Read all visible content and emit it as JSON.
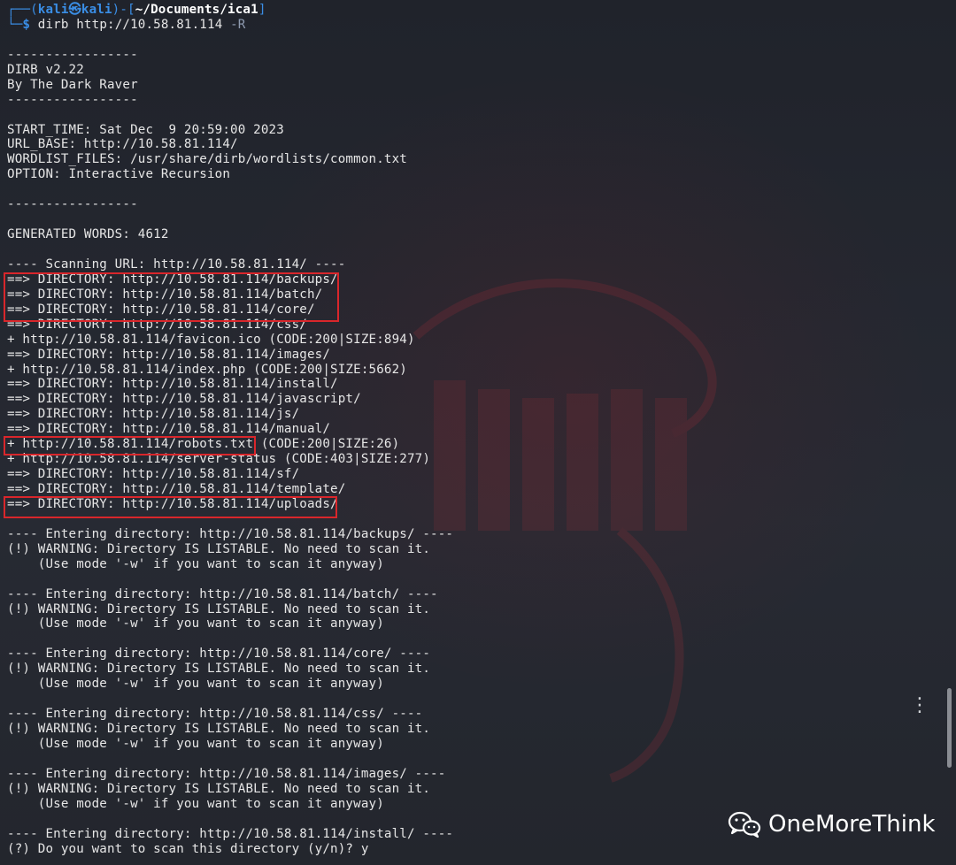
{
  "terminal": {
    "prompt": {
      "frame_start": "┌──(",
      "user": "kali㉿kali",
      "frame_mid": ")-[",
      "path": "~/Documents/ica1",
      "frame_end": "]",
      "frame_second": "└─",
      "dollar": "$ ",
      "command": "dirb http://10.58.81.114 ",
      "flag": "-R"
    },
    "lines": [
      "",
      "-----------------",
      "DIRB v2.22",
      "By The Dark Raver",
      "-----------------",
      "",
      "START_TIME: Sat Dec  9 20:59:00 2023",
      "URL_BASE: http://10.58.81.114/",
      "WORDLIST_FILES: /usr/share/dirb/wordlists/common.txt",
      "OPTION: Interactive Recursion",
      "",
      "-----------------",
      "",
      "GENERATED WORDS: 4612",
      "",
      "---- Scanning URL: http://10.58.81.114/ ----",
      "==> DIRECTORY: http://10.58.81.114/backups/",
      "==> DIRECTORY: http://10.58.81.114/batch/",
      "==> DIRECTORY: http://10.58.81.114/core/",
      "==> DIRECTORY: http://10.58.81.114/css/",
      "+ http://10.58.81.114/favicon.ico (CODE:200|SIZE:894)",
      "==> DIRECTORY: http://10.58.81.114/images/",
      "+ http://10.58.81.114/index.php (CODE:200|SIZE:5662)",
      "==> DIRECTORY: http://10.58.81.114/install/",
      "==> DIRECTORY: http://10.58.81.114/javascript/",
      "==> DIRECTORY: http://10.58.81.114/js/",
      "==> DIRECTORY: http://10.58.81.114/manual/",
      "+ http://10.58.81.114/robots.txt (CODE:200|SIZE:26)",
      "+ http://10.58.81.114/server-status (CODE:403|SIZE:277)",
      "==> DIRECTORY: http://10.58.81.114/sf/",
      "==> DIRECTORY: http://10.58.81.114/template/",
      "==> DIRECTORY: http://10.58.81.114/uploads/",
      "",
      "---- Entering directory: http://10.58.81.114/backups/ ----",
      "(!) WARNING: Directory IS LISTABLE. No need to scan it.",
      "    (Use mode '-w' if you want to scan it anyway)",
      "",
      "---- Entering directory: http://10.58.81.114/batch/ ----",
      "(!) WARNING: Directory IS LISTABLE. No need to scan it.",
      "    (Use mode '-w' if you want to scan it anyway)",
      "",
      "---- Entering directory: http://10.58.81.114/core/ ----",
      "(!) WARNING: Directory IS LISTABLE. No need to scan it.",
      "    (Use mode '-w' if you want to scan it anyway)",
      "",
      "---- Entering directory: http://10.58.81.114/css/ ----",
      "(!) WARNING: Directory IS LISTABLE. No need to scan it.",
      "    (Use mode '-w' if you want to scan it anyway)",
      "",
      "---- Entering directory: http://10.58.81.114/images/ ----",
      "(!) WARNING: Directory IS LISTABLE. No need to scan it.",
      "    (Use mode '-w' if you want to scan it anyway)",
      "",
      "---- Entering directory: http://10.58.81.114/install/ ----",
      "(?) Do you want to scan this directory (y/n)? y"
    ]
  },
  "watermark": {
    "text": "OneMoreThink",
    "icon": "wechat-icon"
  },
  "colors": {
    "background": "#24272f",
    "prompt_blue": "#3a8ee6",
    "highlight_red": "#d9262b",
    "text": "#e6e6e6"
  }
}
